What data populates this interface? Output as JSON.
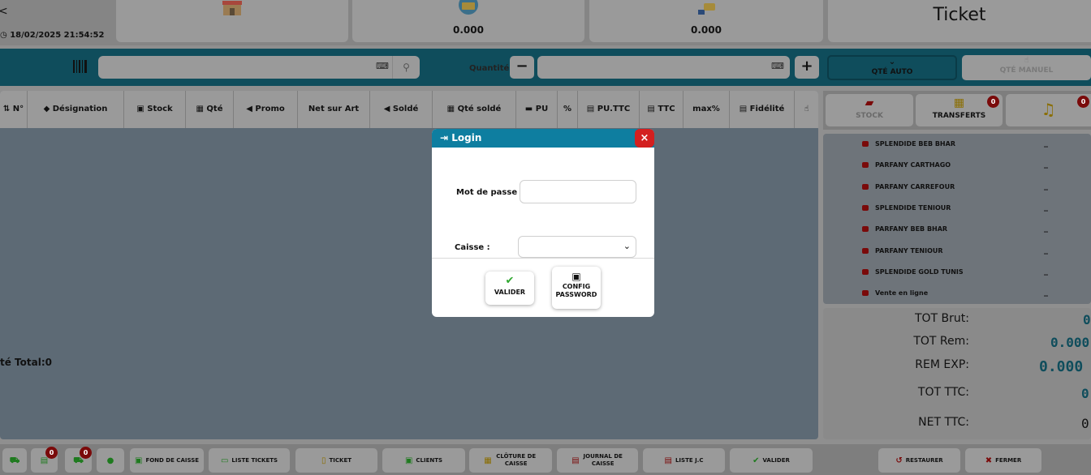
{
  "header": {
    "datetime": "18/02/2025 21:54:52",
    "card_payment_value": "0.000",
    "card_cash_value": "0.000",
    "ticket_title": "Ticket"
  },
  "toolbar": {
    "quantity_label": "Quantité",
    "minus_label": "−",
    "plus_label": "+",
    "qte_auto_label": "QTÉ AUTO",
    "qte_manuel_label": "QTÉ MANUEL"
  },
  "table": {
    "columns": [
      "N°",
      "Désignation",
      "Stock",
      "Qté",
      "Promo",
      "Net sur Art",
      "Soldé",
      "Qté soldé",
      "PU",
      "%",
      "PU.TTC",
      "TTC",
      "max%",
      "Fidélité",
      ""
    ],
    "qte_total_label": "té Total:0"
  },
  "right_tabs": {
    "stock_label": "STOCK",
    "transferts_label": "TRANSFERTS",
    "transferts_badge": "0",
    "notifications_badge": "0"
  },
  "stores": [
    {
      "name": "SPLENDIDE BEB BHAR",
      "value": "_"
    },
    {
      "name": "PARFANY CARTHAGO",
      "value": "_"
    },
    {
      "name": "PARFANY CARREFOUR",
      "value": "_"
    },
    {
      "name": "SPLENDIDE TENIOUR",
      "value": "_"
    },
    {
      "name": "PARFANY BEB BHAR",
      "value": "_"
    },
    {
      "name": "PARFANY TENIOUR",
      "value": "_"
    },
    {
      "name": "SPLENDIDE GOLD TUNIS",
      "value": "_"
    },
    {
      "name": "Vente en ligne",
      "value": "_"
    }
  ],
  "totals": [
    {
      "label": "TOT Brut:",
      "value": "0"
    },
    {
      "label": "TOT Rem:",
      "value": "0.000"
    },
    {
      "label": "REM EXP:",
      "value": "0.000"
    },
    {
      "label": "TOT TTC:",
      "value": "0"
    },
    {
      "label": "NET TTC:",
      "value": "0"
    }
  ],
  "bottom_bar": {
    "badge_1": "0",
    "badge_2": "0",
    "fond_de_caisse": "FOND DE CAISSE",
    "liste_tickets": "LISTE TICKETS",
    "ticket": "TICKET",
    "clients": "CLIENTS",
    "cloture_de_caisse": "CLÔTURE DE CAISSE",
    "journal_de_caisse": "JOURNAL DE CAISSE",
    "liste_jc": "LISTE J.C",
    "valider": "VALIDER",
    "restaurer": "RESTAURER",
    "fermer": "FERMER"
  },
  "login_modal": {
    "title": "Login",
    "close_label": "×",
    "password_label": "Mot de passe :",
    "password_value": "",
    "caisse_label": "Caisse :",
    "caisse_value": "",
    "validate_label": "VALIDER",
    "config_password_label": "CONFIG PASSWORD"
  }
}
